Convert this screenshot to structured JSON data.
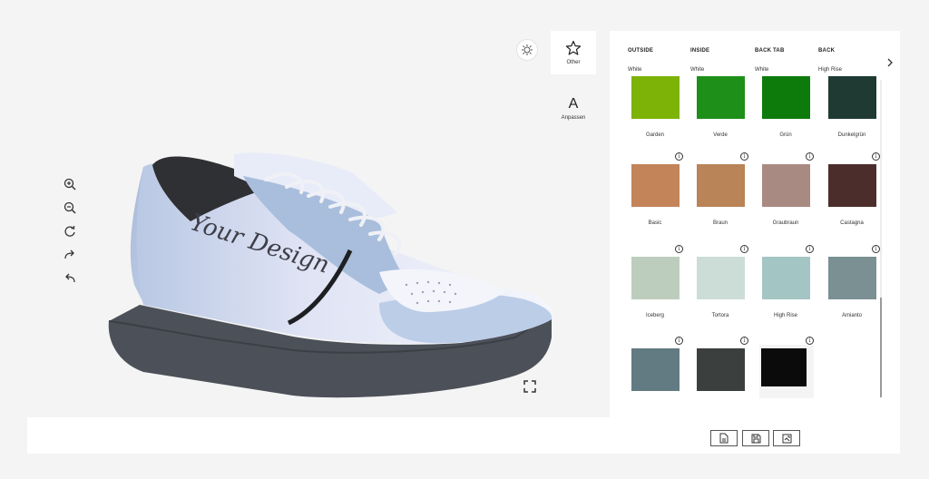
{
  "side_tabs": [
    {
      "label": "Other",
      "icon": "star-icon"
    },
    {
      "label": "Anpassen",
      "icon": "letter-a-icon",
      "glyph": "A"
    }
  ],
  "panel": {
    "tabs": [
      "OUTSIDE",
      "INSIDE",
      "BACK TAB",
      "BACK"
    ],
    "values": [
      "White",
      "White",
      "White",
      "High Rise"
    ],
    "swatches": [
      {
        "name": "Garden",
        "color": "#7db206",
        "info": false
      },
      {
        "name": "Verde",
        "color": "#1e8f18",
        "info": false
      },
      {
        "name": "Grün",
        "color": "#0d7b0b",
        "info": false
      },
      {
        "name": "Dunkelgrün",
        "color": "#1f3a33",
        "info": false
      },
      {
        "name": "Basic",
        "color": "#c38459",
        "info": true
      },
      {
        "name": "Braun",
        "color": "#b98458",
        "info": true
      },
      {
        "name": "Graubraun",
        "color": "#a98a83",
        "info": true
      },
      {
        "name": "Castagna",
        "color": "#4b2e2b",
        "info": true
      },
      {
        "name": "Iceberg",
        "color": "#bdcdbd",
        "info": true
      },
      {
        "name": "Tortora",
        "color": "#ccdcd6",
        "info": true
      },
      {
        "name": "High Rise",
        "color": "#a3c5c3",
        "info": true
      },
      {
        "name": "Amianto",
        "color": "#7a9093",
        "info": true
      },
      {
        "name": "",
        "color": "#627a81",
        "info": true
      },
      {
        "name": "",
        "color": "#3b403f",
        "info": true
      },
      {
        "name": "",
        "color": "#0b0b0b",
        "info": true,
        "selected": true
      }
    ]
  },
  "shoe": {
    "print_text": "Your Design"
  },
  "colors": {
    "accent": "#222222",
    "panel_bg": "#ffffff",
    "page_bg": "#f4f4f4"
  }
}
